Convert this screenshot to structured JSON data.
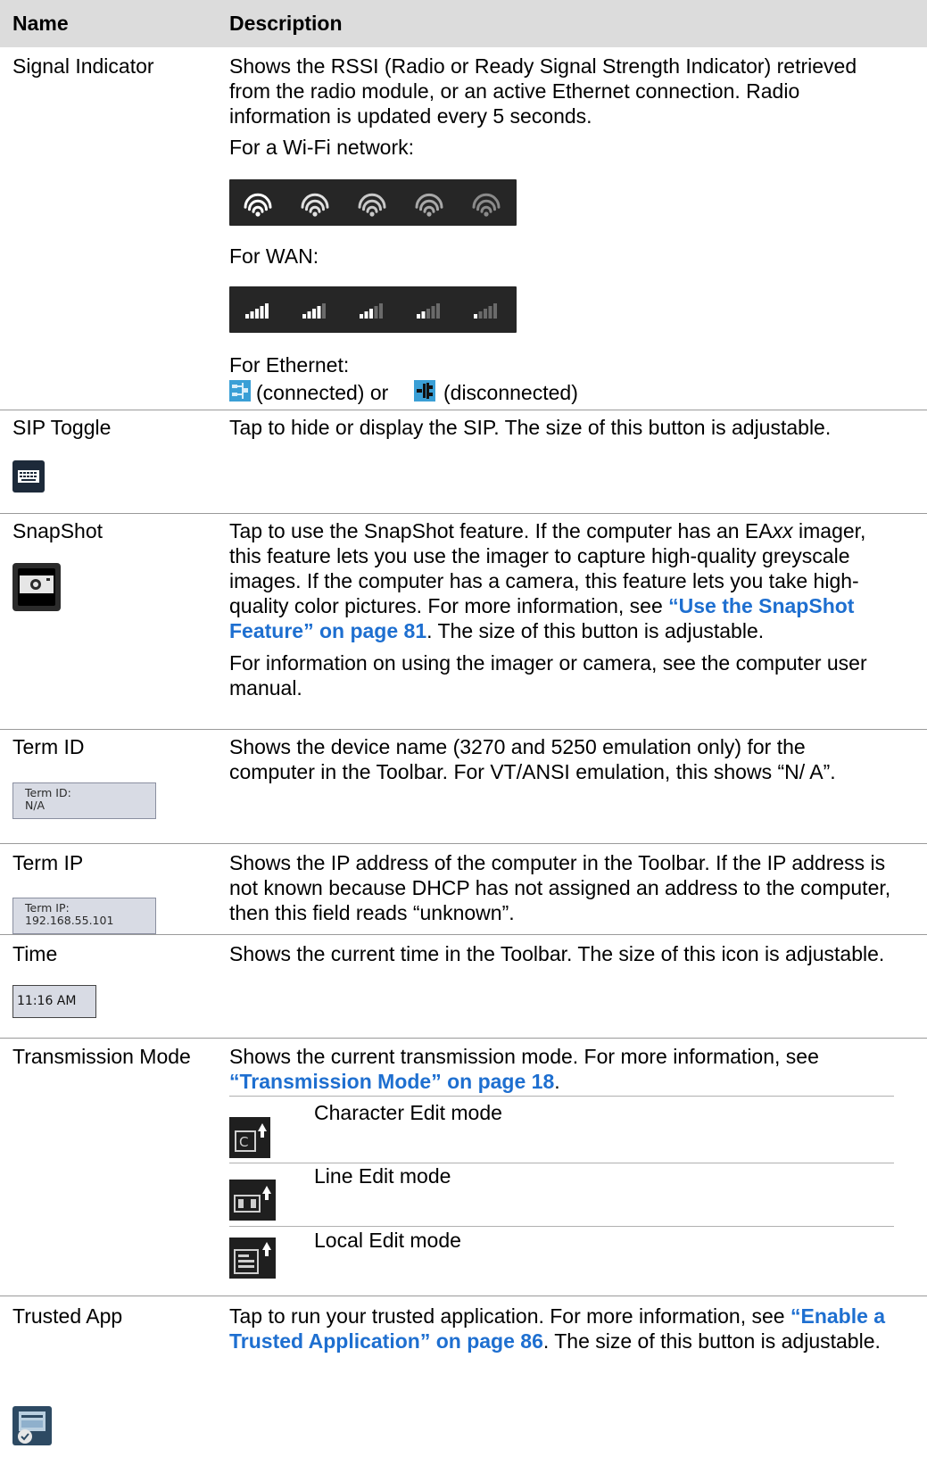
{
  "header": {
    "name": "Name",
    "description": "Description"
  },
  "rows": {
    "signal": {
      "name": "Signal Indicator",
      "desc": "Shows the RSSI (Radio or Ready Signal Strength Indicator) retrieved from the radio module, or an active Ethernet connection. Radio information is updated every 5 seconds.",
      "wifi_label": "For a Wi-Fi network:",
      "wan_label": "For WAN:",
      "eth_label": "For Ethernet:",
      "eth_connected": "(connected) or",
      "eth_disconnected": "(disconnected)",
      "wifi_levels": [
        5,
        4,
        3,
        2,
        1
      ],
      "wan_levels": [
        5,
        4,
        3,
        2,
        1
      ]
    },
    "sip": {
      "name": "SIP Toggle",
      "desc": "Tap to hide or display the SIP. The size of this button is adjustable."
    },
    "snapshot": {
      "name": "SnapShot",
      "desc_a": "Tap to use the SnapShot feature. If the computer has an EA",
      "desc_em": "xx",
      "desc_b": " imager, this feature lets you use the imager to capture high-quality greyscale images. If the computer has a camera, this feature lets you take high-quality color pictures. For more information, see ",
      "link": "“Use the SnapShot Feature” on page 81",
      "desc_c": ". The size of this button is adjustable.",
      "desc2": "For information on using the imager or camera, see the computer user manual."
    },
    "termid": {
      "name": "Term ID",
      "desc": "Shows the device name (3270 and 5250 emulation only) for the computer in the Toolbar. For VT/ANSI emulation, this shows “N/ A”.",
      "field_label": "Term ID:",
      "field_value": "N/A"
    },
    "termip": {
      "name": "Term IP",
      "desc": "Shows the IP address of the computer in the Toolbar. If the IP address is not known because DHCP has not assigned an address to the computer, then this field reads “unknown”.",
      "field_label": "Term IP:",
      "field_value": "192.168.55.101"
    },
    "time": {
      "name": "Time",
      "desc": "Shows the current time in the Toolbar. The size of this icon is adjustable.",
      "clock": "11:16 AM"
    },
    "transmission": {
      "name": "Transmission Mode",
      "desc_a": "Shows the current transmission mode. For more information, see ",
      "link": "“Transmission Mode” on page 18",
      "desc_b": ".",
      "modes": [
        "Character Edit mode",
        "Line Edit mode",
        "Local Edit mode"
      ]
    },
    "trusted": {
      "name": "Trusted App",
      "desc_a": "Tap to run your trusted application. For more information, see ",
      "link": "“Enable a Trusted Application” on page 86",
      "desc_b": ". The size of this button is adjustable."
    }
  },
  "colors": {
    "link": "#1e6fd0",
    "header_bg": "#dcdcdc",
    "strip_bg": "#262626"
  },
  "icons": [
    "wifi-icon",
    "wan-signal-icon",
    "ethernet-icon",
    "keyboard-icon",
    "camera-icon",
    "char-edit-icon",
    "line-edit-icon",
    "local-edit-icon",
    "trusted-app-icon"
  ]
}
